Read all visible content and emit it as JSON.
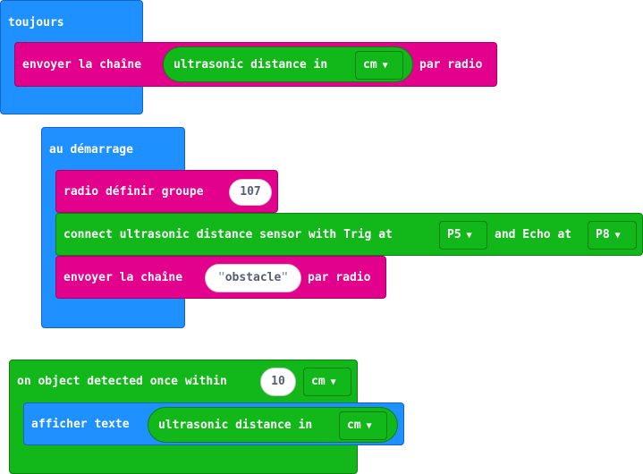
{
  "forever": {
    "label": "toujours",
    "send": {
      "label": "envoyer la chaîne",
      "reporter": "ultrasonic distance in",
      "unit": "cm",
      "suffix": "par radio"
    }
  },
  "on_start": {
    "label": "au démarrage",
    "radio_group": {
      "label": "radio définir groupe",
      "value": "107"
    },
    "connect": {
      "label": "connect ultrasonic distance sensor with Trig at",
      "trig": "P5",
      "and_echo": "and Echo at",
      "echo": "P8"
    },
    "send": {
      "label": "envoyer la chaîne",
      "value": "obstacle",
      "suffix": "par radio"
    }
  },
  "on_detected": {
    "label": "on object detected once within",
    "distance": "10",
    "unit": "cm",
    "show": {
      "label": "afficher texte",
      "reporter": "ultrasonic distance in",
      "unit": "cm"
    }
  },
  "colors": {
    "basic": "#1e90ff",
    "radio": "#e3008c",
    "sonar": "#12b81a"
  }
}
